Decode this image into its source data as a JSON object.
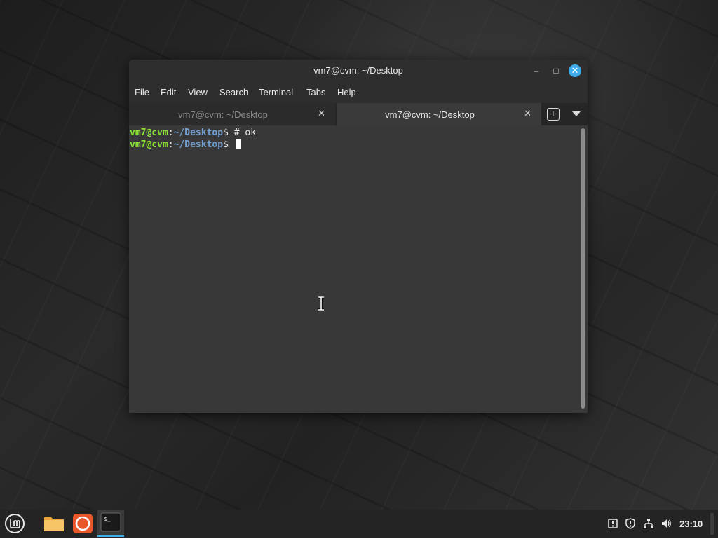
{
  "window": {
    "title": "vm7@cvm: ~/Desktop",
    "minimize_glyph": "–",
    "maximize_glyph": "□",
    "close_glyph": "✕"
  },
  "menubar": {
    "items": [
      {
        "label": "File"
      },
      {
        "label": "Edit"
      },
      {
        "label": "View"
      },
      {
        "label": "Search"
      },
      {
        "label": "Terminal"
      },
      {
        "label": "Tabs"
      },
      {
        "label": "Help"
      }
    ]
  },
  "tabs": [
    {
      "label": "vm7@cvm: ~/Desktop",
      "active": false,
      "close_glyph": "✕"
    },
    {
      "label": "vm7@cvm: ~/Desktop",
      "active": true,
      "close_glyph": "✕"
    }
  ],
  "tab_controls": {
    "new_tab_glyph": "+"
  },
  "terminal": {
    "lines": [
      {
        "user": "vm7@cvm",
        "sep": ":",
        "path": "~/Desktop",
        "symbol": "$",
        "command": " # ok"
      },
      {
        "user": "vm7@cvm",
        "sep": ":",
        "path": "~/Desktop",
        "symbol": "$",
        "command": " "
      }
    ],
    "colors": {
      "user": "#8ae234",
      "path": "#729fcf",
      "text": "#e8e8e8",
      "background": "#383838"
    }
  },
  "taskbar": {
    "apps": [
      {
        "name": "Files",
        "icon": "folder-icon"
      },
      {
        "name": "Firefox",
        "icon": "firefox-icon"
      },
      {
        "name": "Terminal",
        "icon": "terminal-icon",
        "active": true
      }
    ],
    "terminal_icon_text": "$_",
    "tray": [
      "update-manager-icon",
      "shield-icon",
      "network-icon",
      "volume-icon"
    ],
    "clock": "23:10",
    "accent": "#3daee9"
  }
}
